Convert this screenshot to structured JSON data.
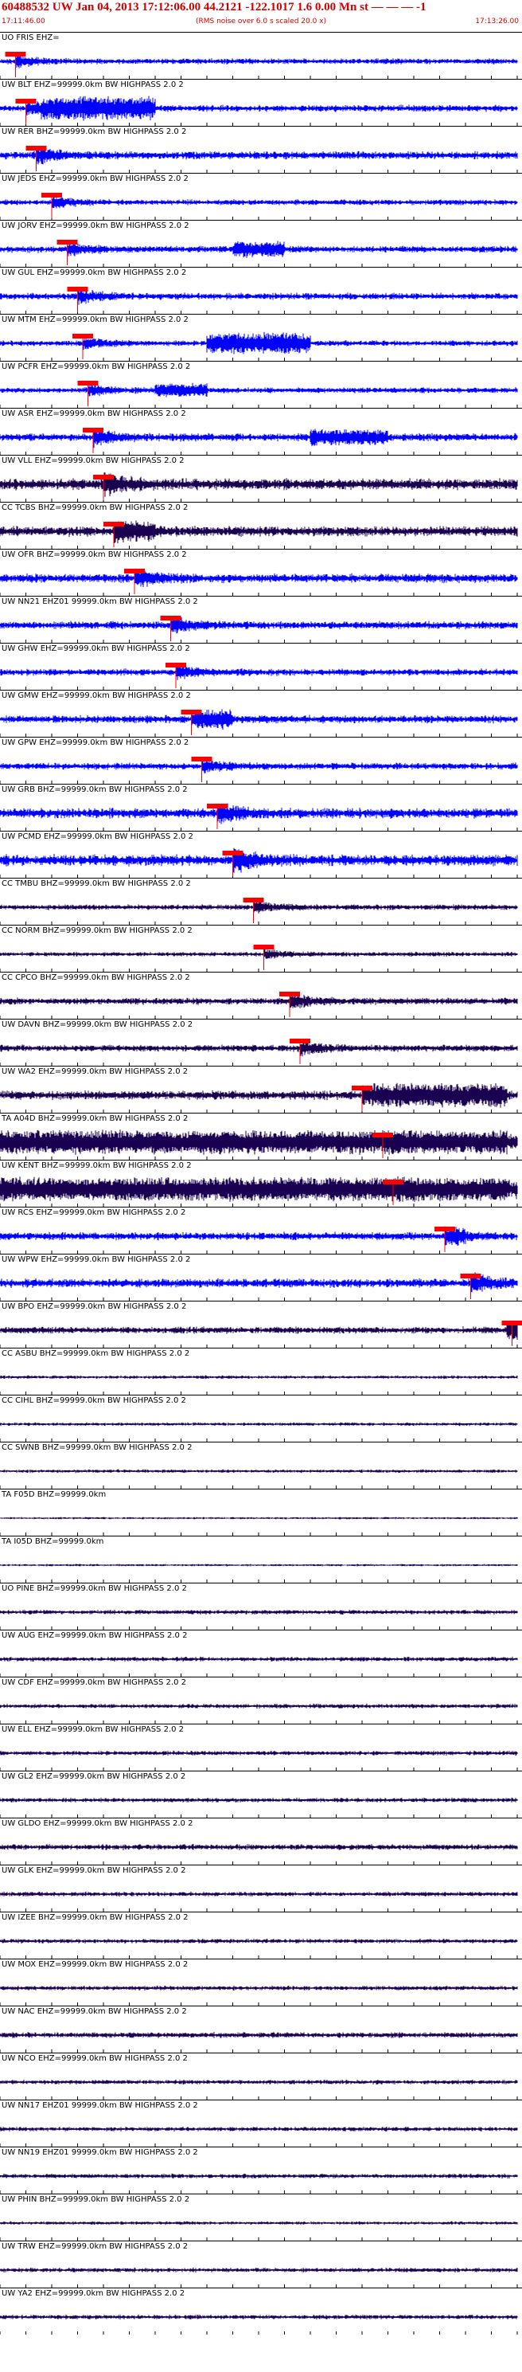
{
  "header": {
    "title": "60488532 UW Jan 04, 2013 17:12:06.00   44.2121 -122.1017  1.6 0.00 Mn st — — —  -1",
    "start_time": "17:11:46.00",
    "end_time": "17:13:26.00",
    "note": "(RMS noise over 6.0 s scaled 20.0 x)"
  },
  "colors": {
    "trace_blue": "#0000ff",
    "trace_dark": "#1a0050",
    "pick_red": "#ff0000",
    "label_black": "#000000"
  },
  "chart_data": {
    "type": "seismogram",
    "x_unit": "time",
    "time_range": [
      "17:11:46.00",
      "17:13:26.00"
    ],
    "minute_marks": [
      "17:12",
      "17:13"
    ],
    "traces": [
      {
        "label": "UO FRIS EHZ",
        "text": "UO FRIS EHZ=",
        "color": "blue",
        "pick": 0.03,
        "amp": 0.25,
        "burst": null
      },
      {
        "label": "UW BLT EHZ",
        "text": "UW BLT EHZ=99999.0km BW  HIGHPASS  2.0  2",
        "color": "blue",
        "pick": 0.05,
        "amp": 0.3,
        "burst": [
          0.08,
          0.3,
          1.0
        ]
      },
      {
        "label": "UW RER BHZ",
        "text": "UW RER BHZ=99999.0km BW  HIGHPASS  2.0  2",
        "color": "blue",
        "pick": 0.07,
        "amp": 0.35,
        "burst": null
      },
      {
        "label": "UW JEDS EHZ",
        "text": "UW JEDS EHZ=99999.0km BW  HIGHPASS  2.0  2",
        "color": "blue",
        "pick": 0.1,
        "amp": 0.25,
        "burst": null
      },
      {
        "label": "UW JORV EHZ",
        "text": "UW JORV EHZ=99999.0km BW  HIGHPASS  2.0  2",
        "color": "blue",
        "pick": 0.13,
        "amp": 0.3,
        "burst": [
          0.45,
          0.55,
          0.7
        ]
      },
      {
        "label": "UW GUL EHZ",
        "text": "UW GUL EHZ=99999.0km BW  HIGHPASS  2.0  2",
        "color": "blue",
        "pick": 0.15,
        "amp": 0.3,
        "burst": null
      },
      {
        "label": "UW MTM EHZ",
        "text": "UW MTM EHZ=99999.0km BW  HIGHPASS  2.0  2",
        "color": "blue",
        "pick": 0.16,
        "amp": 0.25,
        "burst": [
          0.4,
          0.6,
          0.9
        ]
      },
      {
        "label": "UW PCFR EHZ",
        "text": "UW PCFR EHZ=99999.0km BW  HIGHPASS  2.0  2",
        "color": "blue",
        "pick": 0.17,
        "amp": 0.25,
        "burst": [
          0.3,
          0.4,
          0.6
        ]
      },
      {
        "label": "UW ASR EHZ",
        "text": "UW ASR EHZ=99999.0km BW  HIGHPASS  2.0  2",
        "color": "blue",
        "pick": 0.18,
        "amp": 0.35,
        "burst": [
          0.6,
          0.75,
          0.7
        ]
      },
      {
        "label": "UW VLL EHZ",
        "text": "UW VLL EHZ=99999.0km BW  HIGHPASS  2.0  2",
        "color": "dark",
        "pick": 0.2,
        "amp": 0.5,
        "burst": null
      },
      {
        "label": "CC TCBS BHZ",
        "text": "CC TCBS BHZ=99999.0km BW  HIGHPASS  2.0  2",
        "color": "dark",
        "pick": 0.22,
        "amp": 0.45,
        "burst": [
          0.22,
          0.3,
          0.9
        ]
      },
      {
        "label": "UW OFR BHZ",
        "text": "UW OFR BHZ=99999.0km BW  HIGHPASS  2.0  2",
        "color": "blue",
        "pick": 0.26,
        "amp": 0.4,
        "burst": null
      },
      {
        "label": "UW NN21 EHZ",
        "text": "UW NN21 EHZ01 99999.0km BW  HIGHPASS  2.0  2",
        "color": "blue",
        "pick": 0.33,
        "amp": 0.35,
        "burst": null
      },
      {
        "label": "UW GHW EHZ",
        "text": "UW GHW EHZ=99999.0km BW  HIGHPASS  2.0  2",
        "color": "blue",
        "pick": 0.34,
        "amp": 0.3,
        "burst": null
      },
      {
        "label": "UW GMW EHZ",
        "text": "UW GMW EHZ=99999.0km BW  HIGHPASS  2.0  2",
        "color": "blue",
        "pick": 0.37,
        "amp": 0.35,
        "burst": [
          0.38,
          0.45,
          0.9
        ]
      },
      {
        "label": "UW GPW EHZ",
        "text": "UW GPW EHZ=99999.0km BW  HIGHPASS  2.0  2",
        "color": "blue",
        "pick": 0.39,
        "amp": 0.3,
        "burst": null
      },
      {
        "label": "UW GRB BHZ",
        "text": "UW GRB BHZ=99999.0km BW  HIGHPASS  2.0  2",
        "color": "blue",
        "pick": 0.42,
        "amp": 0.45,
        "burst": null
      },
      {
        "label": "UW PCMD EHZ",
        "text": "UW PCMD EHZ=99999.0km BW  HIGHPASS  2.0  2",
        "color": "blue",
        "pick": 0.45,
        "amp": 0.5,
        "burst": null
      },
      {
        "label": "CC TMBU BHZ",
        "text": "CC TMBU BHZ=99999.0km BW  HIGHPASS  2.0  2",
        "color": "dark",
        "pick": 0.49,
        "amp": 0.25,
        "burst": null
      },
      {
        "label": "CC NORM BHZ",
        "text": "CC NORM BHZ=99999.0km BW  HIGHPASS  2.0  2",
        "color": "dark",
        "pick": 0.51,
        "amp": 0.2,
        "burst": null
      },
      {
        "label": "CC CPCO BHZ",
        "text": "CC CPCO BHZ=99999.0km BW  HIGHPASS  2.0  2",
        "color": "dark",
        "pick": 0.56,
        "amp": 0.3,
        "burst": null
      },
      {
        "label": "UW DAVN BHZ",
        "text": "UW DAVN BHZ=99999.0km BW  HIGHPASS  2.0  2",
        "color": "dark",
        "pick": 0.58,
        "amp": 0.3,
        "burst": null
      },
      {
        "label": "UW WA2 EHZ",
        "text": "UW WA2 EHZ=99999.0km BW  HIGHPASS  2.0  2",
        "color": "dark",
        "pick": 0.7,
        "amp": 0.4,
        "burst": [
          0.72,
          0.98,
          1.0
        ]
      },
      {
        "label": "TA A04D BHZ",
        "text": "TA A04D BHZ=99999.0km BW  HIGHPASS  2.0  2",
        "color": "dark",
        "pick": 0.74,
        "amp": 0.8,
        "burst": [
          0.0,
          0.98,
          1.0
        ]
      },
      {
        "label": "UW KENT BHZ",
        "text": "UW KENT BHZ=99999.0km BW  HIGHPASS  2.0  2",
        "color": "dark",
        "pick": 0.76,
        "amp": 0.9,
        "burst": [
          0.0,
          0.98,
          1.0
        ]
      },
      {
        "label": "UW RCS EHZ",
        "text": "UW RCS EHZ=99999.0km BW  HIGHPASS  2.0  2",
        "color": "blue",
        "pick": 0.86,
        "amp": 0.35,
        "burst": [
          0.86,
          0.9,
          0.8
        ]
      },
      {
        "label": "UW WPW EHZ",
        "text": "UW WPW EHZ=99999.0km BW  HIGHPASS  2.0  2",
        "color": "blue",
        "pick": 0.91,
        "amp": 0.4,
        "burst": null
      },
      {
        "label": "UW BPO EHZ",
        "text": "UW BPO EHZ=99999.0km BW  HIGHPASS  2.0  2",
        "color": "dark",
        "pick": 0.99,
        "amp": 0.3,
        "burst": [
          0.98,
          1.0,
          0.9
        ]
      },
      {
        "label": "CC ASBU BHZ",
        "text": "CC ASBU BHZ=99999.0km BW  HIGHPASS  2.0  2",
        "color": "dark",
        "pick": null,
        "amp": 0.15,
        "burst": null
      },
      {
        "label": "CC CIHL BHZ",
        "text": "CC CIHL BHZ=99999.0km BW  HIGHPASS  2.0  2",
        "color": "dark",
        "pick": null,
        "amp": 0.15,
        "burst": null
      },
      {
        "label": "CC SWNB BHZ",
        "text": "CC SWNB BHZ=99999.0km BW  HIGHPASS  2.0  2",
        "color": "dark",
        "pick": null,
        "amp": 0.15,
        "burst": null
      },
      {
        "label": "TA F05D BHZ",
        "text": "TA F05D BHZ=99999.0km",
        "color": "dark",
        "pick": null,
        "amp": 0.1,
        "burst": null
      },
      {
        "label": "TA I05D BHZ",
        "text": "TA I05D BHZ=99999.0km",
        "color": "dark",
        "pick": null,
        "amp": 0.1,
        "burst": null
      },
      {
        "label": "UO PINE BHZ",
        "text": "UO PINE BHZ=99999.0km BW  HIGHPASS  2.0  2",
        "color": "dark",
        "pick": null,
        "amp": 0.2,
        "burst": null
      },
      {
        "label": "UW AUG EHZ",
        "text": "UW AUG EHZ=99999.0km BW  HIGHPASS  2.0  2",
        "color": "dark",
        "pick": null,
        "amp": 0.2,
        "burst": null
      },
      {
        "label": "UW CDF EHZ",
        "text": "UW CDF EHZ=99999.0km BW  HIGHPASS  2.0  2",
        "color": "dark",
        "pick": null,
        "amp": 0.2,
        "burst": null
      },
      {
        "label": "UW ELL EHZ",
        "text": "UW ELL EHZ=99999.0km BW  HIGHPASS  2.0  2",
        "color": "dark",
        "pick": null,
        "amp": 0.2,
        "burst": null
      },
      {
        "label": "UW GL2 EHZ",
        "text": "UW GL2 EHZ=99999.0km BW  HIGHPASS  2.0  2",
        "color": "dark",
        "pick": null,
        "amp": 0.2,
        "burst": null
      },
      {
        "label": "UW GLDO EHZ",
        "text": "UW GLDO EHZ=99999.0km BW  HIGHPASS  2.0  2",
        "color": "dark",
        "pick": null,
        "amp": 0.25,
        "burst": null
      },
      {
        "label": "UW GLK EHZ",
        "text": "UW GLK EHZ=99999.0km BW  HIGHPASS  2.0  2",
        "color": "dark",
        "pick": null,
        "amp": 0.2,
        "burst": null
      },
      {
        "label": "UW IZEE BHZ",
        "text": "UW IZEE BHZ=99999.0km BW  HIGHPASS  2.0  2",
        "color": "dark",
        "pick": null,
        "amp": 0.2,
        "burst": null
      },
      {
        "label": "UW MOX EHZ",
        "text": "UW MOX EHZ=99999.0km BW  HIGHPASS  2.0  2",
        "color": "dark",
        "pick": null,
        "amp": 0.2,
        "burst": null
      },
      {
        "label": "UW NAC EHZ",
        "text": "UW NAC EHZ=99999.0km BW  HIGHPASS  2.0  2",
        "color": "dark",
        "pick": null,
        "amp": 0.25,
        "burst": null
      },
      {
        "label": "UW NCO EHZ",
        "text": "UW NCO EHZ=99999.0km BW  HIGHPASS  2.0  2",
        "color": "dark",
        "pick": null,
        "amp": 0.2,
        "burst": null
      },
      {
        "label": "UW NN17 EHZ",
        "text": "UW NN17 EHZ01 99999.0km BW  HIGHPASS  2.0  2",
        "color": "dark",
        "pick": null,
        "amp": 0.2,
        "burst": null
      },
      {
        "label": "UW NN19 EHZ",
        "text": "UW NN19 EHZ01 99999.0km BW  HIGHPASS  2.0  2",
        "color": "dark",
        "pick": null,
        "amp": 0.2,
        "burst": null
      },
      {
        "label": "UW PHIN BHZ",
        "text": "UW PHIN BHZ=99999.0km BW  HIGHPASS  2.0  2",
        "color": "dark",
        "pick": null,
        "amp": 0.15,
        "burst": null
      },
      {
        "label": "UW TRW EHZ",
        "text": "UW TRW EHZ=99999.0km BW  HIGHPASS  2.0  2",
        "color": "dark",
        "pick": null,
        "amp": 0.2,
        "burst": null
      },
      {
        "label": "UW YA2 EHZ",
        "text": "UW YA2 EHZ=99999.0km BW  HIGHPASS  2.0  2",
        "color": "dark",
        "pick": null,
        "amp": 0.2,
        "burst": null
      }
    ]
  }
}
